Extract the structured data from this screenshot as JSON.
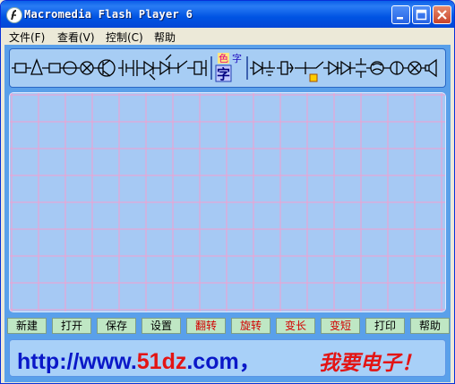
{
  "window": {
    "title": "Macromedia Flash Player 6",
    "title_buttons": [
      "minimize",
      "maximize",
      "close"
    ]
  },
  "menu": [
    {
      "label": "文件(F)"
    },
    {
      "label": "查看(V)"
    },
    {
      "label": "控制(C)"
    },
    {
      "label": "帮助"
    }
  ],
  "toolbar": {
    "icons": [
      "resistor-icon",
      "capacitor-icon",
      "triangle-icon",
      "resistor-icon",
      "ammeter-icon",
      "voltmeter-icon",
      "lamp-icon",
      "transistor-icon",
      "battery-icon",
      "diode-icon",
      "switch-icon",
      "color-text-icon",
      "text-icon",
      "diode-icon",
      "ground-icon",
      "relay-icon",
      "lamp-icon",
      "motor-icon",
      "coil-icon",
      "speaker-icon"
    ],
    "color_label": "色",
    "text_label": "字",
    "text_label_big": "字"
  },
  "buttons": [
    {
      "label": "新建",
      "color": "#000000"
    },
    {
      "label": "打开",
      "color": "#000000"
    },
    {
      "label": "保存",
      "color": "#000000"
    },
    {
      "label": "设置",
      "color": "#000000"
    },
    {
      "label": "翻转",
      "color": "#d30000"
    },
    {
      "label": "旋转",
      "color": "#d30000"
    },
    {
      "label": "变长",
      "color": "#d30000"
    },
    {
      "label": "变短",
      "color": "#d30000"
    },
    {
      "label": "打印",
      "color": "#000000"
    },
    {
      "label": "帮助",
      "color": "#000000"
    }
  ],
  "banner": {
    "url_prefix": "http://www.",
    "url_highlight": "51dz",
    "url_suffix": ".com",
    "separator": "，",
    "slogan": "我要电子！"
  },
  "colors": {
    "grid_line": "#f2a0cf",
    "grid_bg": "#a6c9f4",
    "stage_bg": "#5aa0ea",
    "button_bg": "#bfe7c4"
  }
}
